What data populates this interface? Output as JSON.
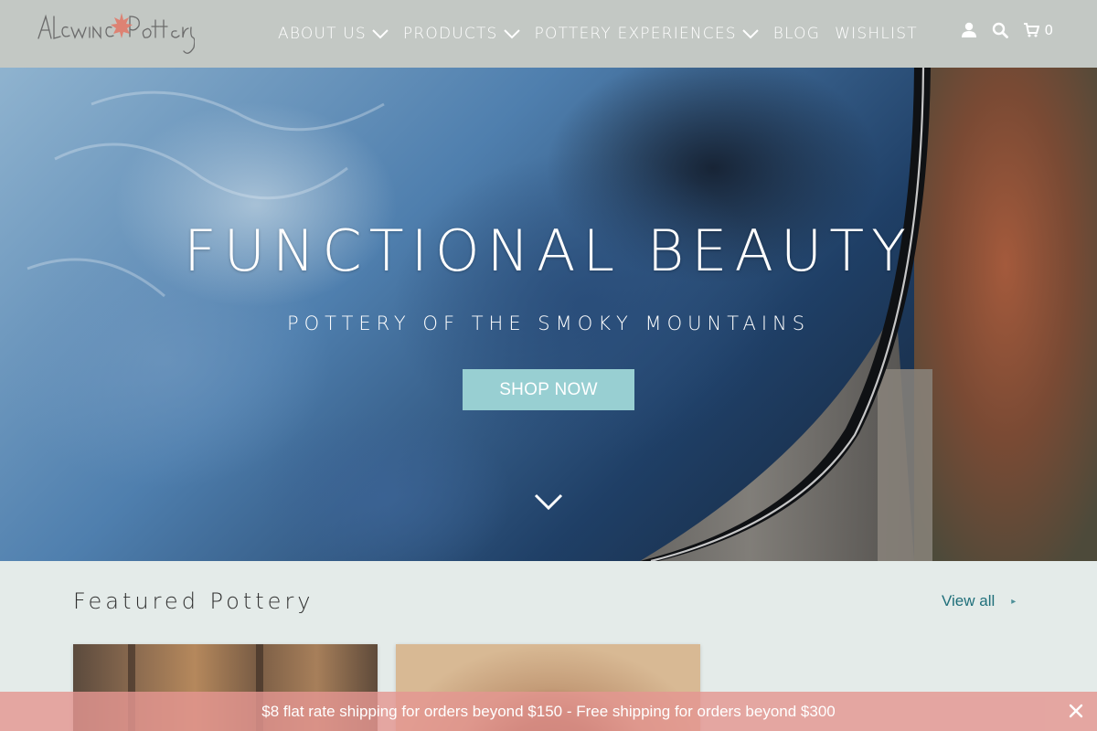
{
  "header": {
    "logo_text": "Alewine Pottery",
    "nav": [
      {
        "label": "ABOUT US",
        "has_dropdown": true
      },
      {
        "label": "PRODUCTS",
        "has_dropdown": true
      },
      {
        "label": "POTTERY EXPERIENCES",
        "has_dropdown": true
      },
      {
        "label": "BLOG",
        "has_dropdown": false
      },
      {
        "label": "WISHLIST",
        "has_dropdown": false
      }
    ],
    "icons": [
      "user-icon",
      "search-icon",
      "cart-icon"
    ],
    "cart_count": "0"
  },
  "hero": {
    "title": "FUNCTIONAL BEAUTY",
    "subtitle": "POTTERY OF THE SMOKY MOUNTAINS",
    "cta_label": "SHOP NOW",
    "scroll_icon": "chevron-down-icon"
  },
  "featured": {
    "title": "Featured Pottery",
    "view_all_label": "View all",
    "view_all_icon": "chevron-right-icon"
  },
  "announcement": {
    "text": "$8 flat rate shipping for orders beyond $150 - Free shipping for orders beyond $300",
    "close_icon": "close-icon"
  },
  "colors": {
    "header_bg": "#c3c8c4",
    "cta_bg": "#98cfd2",
    "link": "#1f6f7a",
    "announcement_bg": "#e49691",
    "page_bg": "#e4ebe9"
  }
}
